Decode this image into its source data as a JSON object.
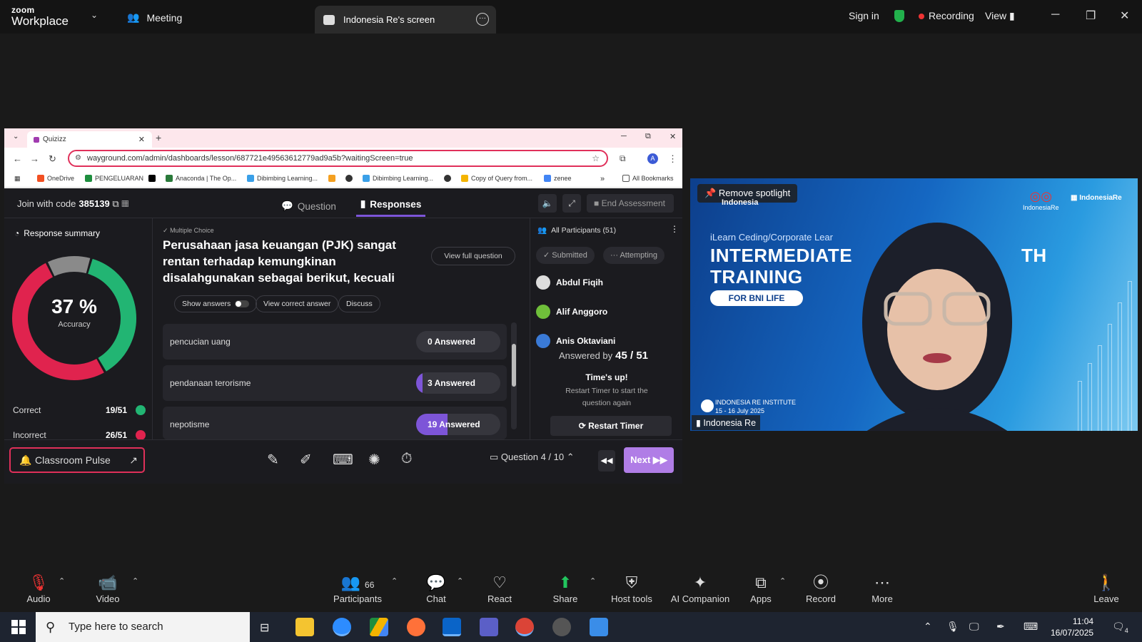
{
  "zoom": {
    "app_title_top": "zoom",
    "app_title_bottom": "Workplace",
    "meeting_tab": "Meeting",
    "share_tab": "Indonesia Re's screen",
    "sign_in": "Sign in",
    "recording": "Recording",
    "view": "View"
  },
  "browser": {
    "tab_title": "Quizizz",
    "url": "wayground.com/admin/dashboards/lesson/687721e49563612779ad9a5b?waitingScreen=true",
    "avatar_letter": "A",
    "bookmarks": [
      "OneDrive",
      "PENGELUARAN",
      "Anaconda | The Op...",
      "Dibimbing Learning...",
      "Dibimbing Learning...",
      "Copy of Query from...",
      "zenee"
    ],
    "all_bookmarks": "All Bookmarks",
    "more_bookmarks": "»"
  },
  "quiz": {
    "join_label": "Join with code",
    "join_code": "385139",
    "tab_question": "Question",
    "tab_responses": "Responses",
    "end_assessment": "End Assessment",
    "summary_title": "Response summary",
    "accuracy_value": "37 %",
    "accuracy_label": "Accuracy",
    "correct_label": "Correct",
    "correct_value": "19/51",
    "incorrect_label": "Incorrect",
    "incorrect_value": "26/51",
    "accuracy_fraction": 0.37,
    "question_type": "Multiple Choice",
    "question_text": "Perusahaan jasa keuangan (PJK) sangat rentan terhadap kemungkinan disalahgunakan sebagai berikut, kecuali",
    "view_full_question": "View full question",
    "show_answers": "Show answers",
    "view_correct_answer": "View correct answer",
    "discuss": "Discuss",
    "answers": [
      {
        "text": "pencucian uang",
        "count_label": "0 Answered",
        "fraction": 0
      },
      {
        "text": "pendanaan terorisme",
        "count_label": "3 Answered",
        "fraction": 0.06
      },
      {
        "text": "nepotisme",
        "count_label": "19 Answered",
        "fraction": 0.37
      }
    ],
    "all_participants": "All Participants (51)",
    "filter_submitted": "Submitted",
    "filter_attempting": "Attempting",
    "participants": [
      "Abdul Fiqih",
      "Alif Anggoro",
      "Anis Oktaviani"
    ],
    "answered_by_label": "Answered by",
    "answered_by_value": "45 / 51",
    "times_up": "Time's up!",
    "restart_hint": "Restart Timer to start the question again",
    "restart_timer": "Restart Timer",
    "classroom_pulse": "Classroom Pulse",
    "question_counter": "Question 4 / 10",
    "next": "Next"
  },
  "video": {
    "remove_spotlight": "Remove spotlight",
    "org_top": "Indonesia",
    "subtitle": "iLearn Ceding/Corporate Lear",
    "headline_1": "INTERMEDIATE",
    "headline_2": "TRAINING",
    "headline_tail": "TH",
    "badge": "FOR BNI LIFE",
    "logo_1": "IndonesiaRe",
    "logo_2": "IndonesiaRe",
    "event_line_1": "INDONESIA RE INSTITUTE",
    "event_line_2": "15 - 16 July 2025",
    "speaker_name": "Indonesia Re"
  },
  "toolbar": {
    "audio": "Audio",
    "video": "Video",
    "participants": "Participants",
    "participants_count": "66",
    "chat": "Chat",
    "react": "React",
    "share": "Share",
    "host_tools": "Host tools",
    "ai_companion": "AI Companion",
    "apps": "Apps",
    "record": "Record",
    "more": "More",
    "leave": "Leave"
  },
  "taskbar": {
    "search_placeholder": "Type here to search",
    "time": "11:04",
    "date": "16/07/2025",
    "notification_count": "4"
  },
  "colors": {
    "correct": "#22b573",
    "incorrect": "#e0234e",
    "unattempted": "#8a8a8a",
    "accent": "#7d55d8"
  }
}
